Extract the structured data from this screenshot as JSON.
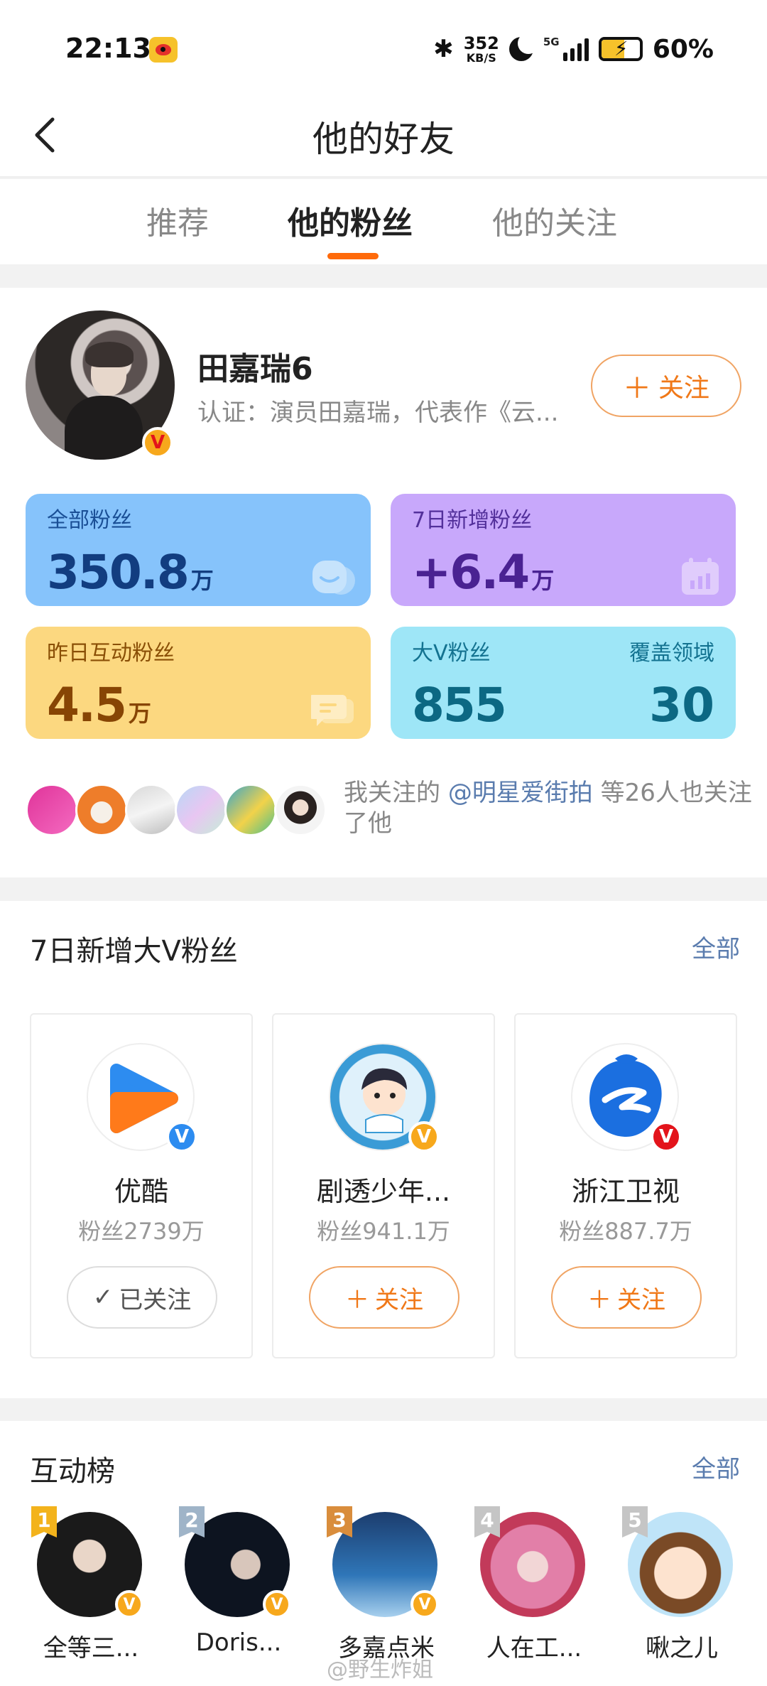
{
  "status_bar": {
    "time": "22:13",
    "net_speed_value": "352",
    "net_speed_unit": "KB/S",
    "network": "5G",
    "battery": "60%",
    "battery_level": 0.6
  },
  "header": {
    "title": "他的好友"
  },
  "tabs": [
    {
      "label": "推荐",
      "active": false
    },
    {
      "label": "他的粉丝",
      "active": true
    },
    {
      "label": "他的关注",
      "active": false
    }
  ],
  "profile": {
    "name": "田嘉瑞6",
    "cert": "认证：演员田嘉瑞，代表作《云...",
    "follow_label": "关注",
    "follow_icon": "plus-icon"
  },
  "stats": {
    "all_fans": {
      "label": "全部粉丝",
      "value": "350.8",
      "unit": "万"
    },
    "new_7d": {
      "label": "7日新增粉丝",
      "value": "+6.4",
      "unit": "万"
    },
    "yesterday_interactive": {
      "label": "昨日互动粉丝",
      "value": "4.5",
      "unit": "万"
    },
    "bigv_fans": {
      "label": "大V粉丝",
      "value": "855"
    },
    "coverage": {
      "label": "覆盖领域",
      "value": "30"
    }
  },
  "mutual": {
    "prefix": "我关注的 ",
    "mention": "@明星爱街拍",
    "suffix": " 等26人也关注了他",
    "avatar_count": 6
  },
  "bigv_section": {
    "title": "7日新增大V粉丝",
    "all_label": "全部",
    "cards": [
      {
        "name": "优酷",
        "fans": "粉丝2739万",
        "button": "已关注",
        "followed": true,
        "badge": "blue"
      },
      {
        "name": "剧透少年...",
        "fans": "粉丝941.1万",
        "button": "关注",
        "followed": false,
        "badge": "orange"
      },
      {
        "name": "浙江卫视",
        "fans": "粉丝887.7万",
        "button": "关注",
        "followed": false,
        "badge": "red"
      }
    ]
  },
  "rank_section": {
    "title": "互动榜",
    "all_label": "全部",
    "items": [
      {
        "rank": "1",
        "name": "全等三..."
      },
      {
        "rank": "2",
        "name": "Doris..."
      },
      {
        "rank": "3",
        "name": "多嘉点米"
      },
      {
        "rank": "4",
        "name": "人在工..."
      },
      {
        "rank": "5",
        "name": "啾之儿"
      }
    ]
  },
  "watermark": "@野生炸姐",
  "colors": {
    "accent": "#ff6a0a",
    "follow_text": "#f07818",
    "link": "#5a7cae",
    "rank_gold": "#f3b31c",
    "rank_silver": "#9fb4c8",
    "rank_bronze": "#d98d3c",
    "rank_other": "#c5c5c5"
  }
}
